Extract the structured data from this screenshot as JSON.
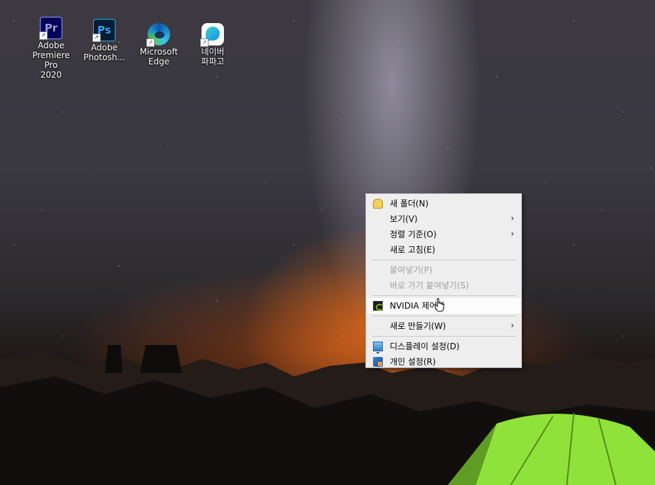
{
  "desktop_icons": [
    {
      "label_line1": "Adobe",
      "label_line2": "Premiere Pro",
      "label_line3": "2020",
      "glyph": "Pr",
      "icon": "premiere-pro-icon"
    },
    {
      "label_line1": "Adobe",
      "label_line2": "Photosh...",
      "glyph": "Ps",
      "icon": "photoshop-icon"
    },
    {
      "label_line1": "Microsoft",
      "label_line2": "Edge",
      "icon": "edge-icon"
    },
    {
      "label_line1": "네이버",
      "label_line2": "파파고",
      "icon": "papago-icon"
    }
  ],
  "context_menu": {
    "new_folder": "새 폴더(N)",
    "view": "보기(V)",
    "sort_by": "정렬 기준(O)",
    "refresh": "새로 고침(E)",
    "paste": "붙여넣기(P)",
    "paste_shortcut": "바로 가기 붙여넣기(S)",
    "nvidia_control_panel": "NVIDIA 제어판",
    "new": "새로 만들기(W)",
    "display_settings": "디스플레이 설정(D)",
    "personalize": "개인 설정(R)",
    "submenu_arrow": "›"
  },
  "colors": {
    "menu_background": "#eeeeee",
    "menu_disabled_text": "#a0a0a0",
    "nvidia_green": "#76b900",
    "tent_green": "#8fe23a"
  }
}
